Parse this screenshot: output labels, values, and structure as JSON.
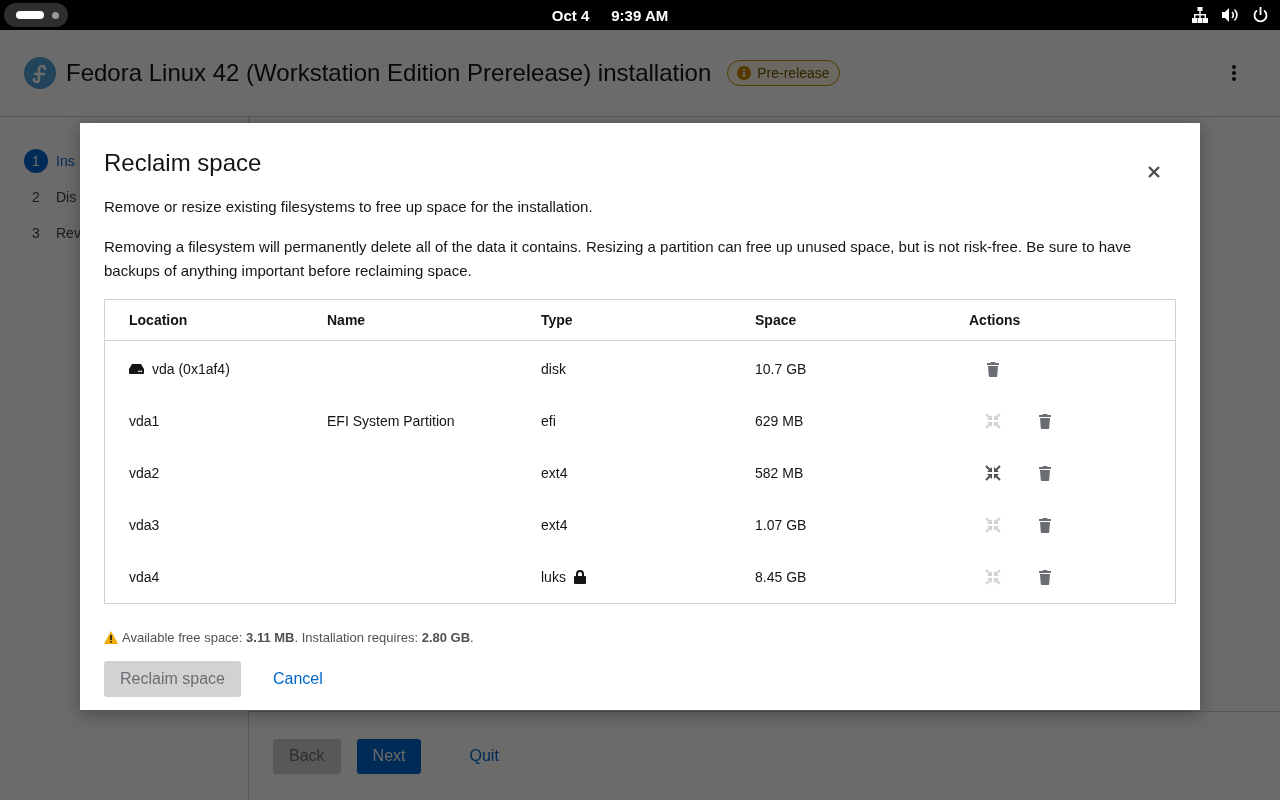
{
  "top_bar": {
    "date": "Oct 4",
    "time": "9:39 AM"
  },
  "header": {
    "title": "Fedora Linux 42 (Workstation Edition Prerelease) installation",
    "badge": "Pre-release"
  },
  "steps": [
    {
      "number": "1",
      "label": "Ins",
      "selected": true
    },
    {
      "number": "2",
      "label": "Dis",
      "selected": false
    },
    {
      "number": "3",
      "label": "Rev",
      "selected": false
    }
  ],
  "footer": {
    "buttons": [
      {
        "label": "Back",
        "kind": "secondary",
        "disabled": true
      },
      {
        "label": "Next",
        "kind": "primary",
        "disabled": false
      },
      {
        "label": "Quit",
        "kind": "link",
        "disabled": false
      }
    ]
  },
  "dialog": {
    "title": "Reclaim space",
    "subtitle": "Remove or resize existing filesystems to free up space for the installation.",
    "warning": "Removing a filesystem will permanently delete all of the data it contains. Resizing a partition can free up unused space, but is not risk-free. Be sure to have backups of anything important before reclaiming space.",
    "table": {
      "columns": [
        "Location",
        "Name",
        "Type",
        "Space",
        "Actions"
      ],
      "rows": [
        {
          "kind": "disk",
          "location": "vda (0x1af4)",
          "type": "disk",
          "space": "10.7 GB"
        },
        {
          "kind": "partition",
          "location": "vda1",
          "name": "EFI System Partition",
          "type": "efi",
          "space": "629 MB",
          "resizable": false,
          "locked": false
        },
        {
          "kind": "partition",
          "location": "vda2",
          "type": "ext4",
          "space": "582 MB",
          "resizable": true,
          "locked": false
        },
        {
          "kind": "partition",
          "location": "vda3",
          "type": "ext4",
          "space": "1.07 GB",
          "resizable": false,
          "locked": false
        },
        {
          "kind": "partition",
          "location": "vda4",
          "type": "luks",
          "space": "8.45 GB",
          "resizable": false,
          "locked": true
        }
      ]
    },
    "status": "Available free space: **3.11 MB**. Installation requires: **2.80 GB**.",
    "buttons": [
      {
        "label": "Reclaim space",
        "kind": "primary",
        "disabled": true
      },
      {
        "label": "Cancel",
        "kind": "link",
        "disabled": false
      }
    ]
  }
}
